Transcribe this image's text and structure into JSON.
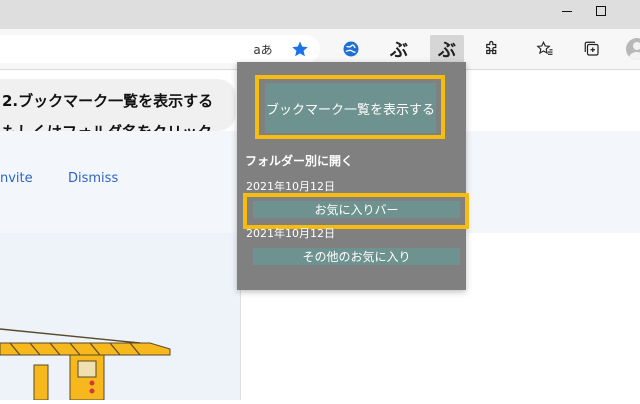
{
  "toolbar": {
    "read_aloud_label": "aあ",
    "extension_1_label": "ぶ",
    "extension_2_label": "ぶ"
  },
  "icons": {
    "minimize": "minimize-icon",
    "maximize": "maximize-icon",
    "favorite_star": "star-icon",
    "globe_extension": "globe-icon",
    "extensions": "puzzle-icon",
    "favorites": "favorites-icon",
    "collections": "collections-icon",
    "profile": "profile-avatar-icon"
  },
  "page": {
    "step2_line1": "2.ブックマーク一覧を表示する",
    "step2_line2": "もしくはフォルダ名をクリック",
    "invite_link": "nvite",
    "dismiss_link": "Dismiss"
  },
  "popup": {
    "show_bookmarks_button": "ブックマーク一覧を表示する",
    "folder_heading": "フォルダー別に開く",
    "groups": [
      {
        "date": "2021年10月12日",
        "folder": "お気に入りバー"
      },
      {
        "date": "2021年10月12日",
        "folder": "その他のお気に入り"
      }
    ]
  },
  "colors": {
    "highlight": "#f6bd10",
    "popup_bg": "#808080",
    "button_bg": "#6e928f",
    "star_blue": "#1a73e8",
    "link_blue": "#2e64c8"
  }
}
